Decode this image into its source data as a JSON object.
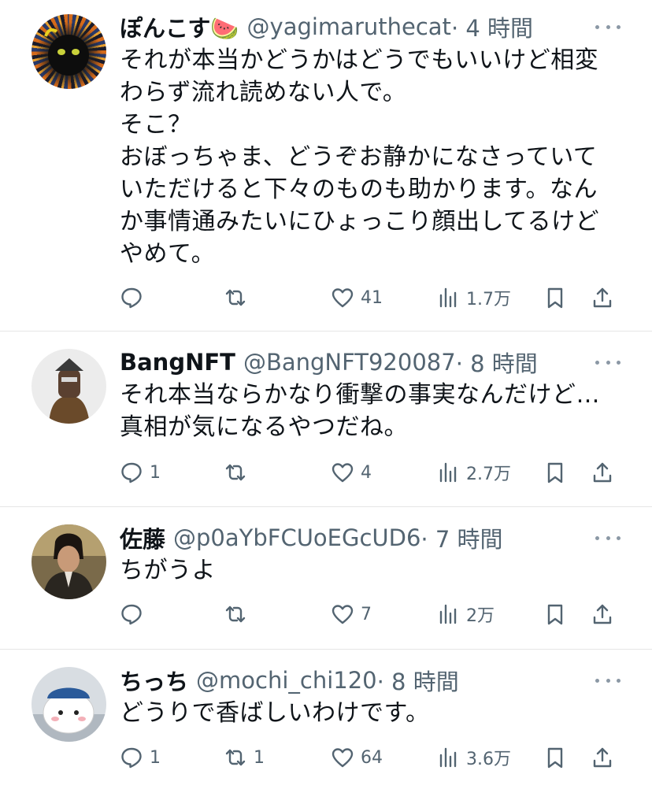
{
  "tweets": [
    {
      "name": "ぽんこす🍉",
      "handle": "@yagimaruthecat",
      "time": "· 4 時間",
      "text": "それが本当かどうかはどうでもいいけど相変わらず流れ読めない人で。\nそこ？\nおぼっちゃま、どうぞお静かになさっていていただけると下々のものも助かります。なんか事情通みたいにひょっこり顔出してるけどやめて。",
      "replies": "",
      "retweets": "",
      "likes": "41",
      "views": "1.7万"
    },
    {
      "name": "BangNFT",
      "handle": "@BangNFT920087",
      "time": "· 8 時間",
      "text": "それ本当ならかなり衝撃の事実なんだけど…真相が気になるやつだね。",
      "replies": "1",
      "retweets": "",
      "likes": "4",
      "views": "2.7万"
    },
    {
      "name": "佐藤",
      "handle": "@p0aYbFCUoEGcUD6",
      "time": "· 7 時間",
      "text": "ちがうよ",
      "replies": "",
      "retweets": "",
      "likes": "7",
      "views": "2万"
    },
    {
      "name": "ちっち",
      "handle": "@mochi_chi120",
      "time": "· 8 時間",
      "text": "どうりで香ばしいわけです。",
      "replies": "1",
      "retweets": "1",
      "likes": "64",
      "views": "3.6万"
    }
  ],
  "icons": {
    "reply": "speech-bubble-icon",
    "retweet": "retweet-arrows-icon",
    "like": "heart-icon",
    "views": "bar-chart-icon",
    "bookmark": "bookmark-icon",
    "share": "share-upload-icon",
    "more": "more-dots-icon"
  }
}
